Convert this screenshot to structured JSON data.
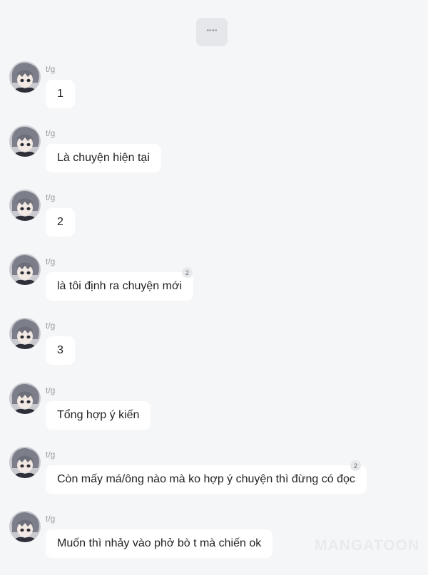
{
  "top_pill": {
    "label": "\"\"\"\""
  },
  "messages": [
    {
      "sender": "t/g",
      "text": "1"
    },
    {
      "sender": "t/g",
      "text": "Là chuyện hiện tại"
    },
    {
      "sender": "t/g",
      "text": "2"
    },
    {
      "sender": "t/g",
      "text": "là tôi định ra chuyện mới",
      "reaction_count": "2"
    },
    {
      "sender": "t/g",
      "text": "3"
    },
    {
      "sender": "t/g",
      "text": "Tổng hợp ý kiến"
    },
    {
      "sender": "t/g",
      "text": "Còn mấy má/ông nào mà ko hợp ý chuyện thì đừng có đọc",
      "reaction_count": "2"
    },
    {
      "sender": "t/g",
      "text": "Muốn thì nhảy vào phở bò t mà chiến ok"
    }
  ],
  "watermark": "MANGATOON",
  "colors": {
    "background": "#f5f6f8",
    "bubble": "#ffffff",
    "sender_text": "#9a9ca3"
  }
}
